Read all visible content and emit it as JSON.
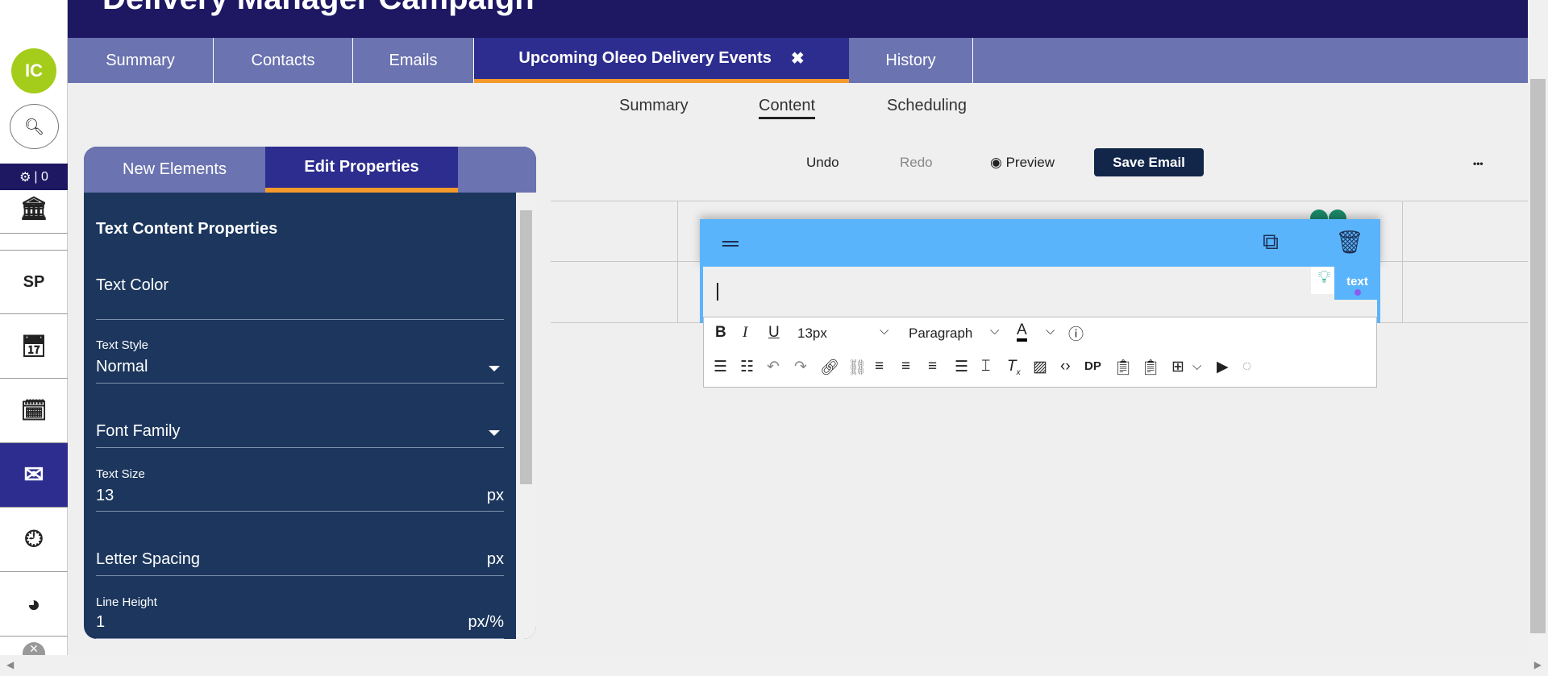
{
  "header": {
    "title": "Delivery Manager Campaign"
  },
  "sidebar": {
    "avatar": "IC",
    "gear_count": "| 0",
    "items": [
      {
        "name": "institution"
      },
      {
        "label": "SP"
      },
      {
        "name": "calendar-star"
      },
      {
        "name": "calendar"
      },
      {
        "name": "email"
      },
      {
        "name": "clock"
      },
      {
        "name": "pie-chart"
      }
    ]
  },
  "tabs": [
    "Summary",
    "Contacts",
    "Emails",
    "Upcoming Oleeo Delivery Events",
    "History"
  ],
  "subtabs": [
    "Summary",
    "Content",
    "Scheduling"
  ],
  "panel": {
    "tabs": [
      "New Elements",
      "Edit Properties"
    ],
    "section": "Text Content Properties",
    "fields": {
      "text_color": "Text Color",
      "text_style_label": "Text Style",
      "text_style": "Normal",
      "font_family": "Font Family",
      "text_size_label": "Text Size",
      "text_size": "13",
      "text_size_unit": "px",
      "letter_spacing": "Letter Spacing",
      "letter_spacing_unit": "px",
      "line_height_label": "Line Height",
      "line_height": "1",
      "line_height_unit": "px/%"
    }
  },
  "toolbar": {
    "undo": "Undo",
    "redo": "Redo",
    "preview": "Preview",
    "save": "Save Email",
    "more": "•••"
  },
  "editor": {
    "badge": "text",
    "font_size": "13px",
    "block": "Paragraph",
    "dp": "DP"
  }
}
